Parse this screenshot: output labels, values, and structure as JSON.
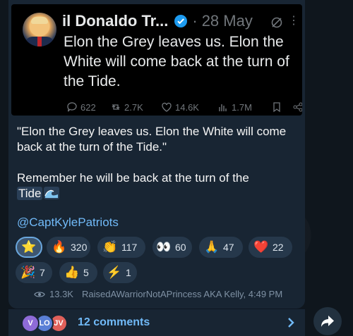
{
  "tweet": {
    "name": "il Donaldo Tr...",
    "date": "28 May",
    "text": "Elon the Grey leaves us. Elon the White will come back at the turn of the Tide.",
    "replies": "622",
    "retweets": "2.7K",
    "likes": "14.6K",
    "views": "1.7M",
    "icons": [
      "verified-icon",
      "grok-icon",
      "more-icon",
      "reply-icon",
      "retweet-icon",
      "like-icon",
      "views-icon",
      "bookmark-icon",
      "share-icon"
    ]
  },
  "message": {
    "quote": "\"Elon the Grey leaves us. Elon the White will come back at the turn of the Tide.\"",
    "line2": "Remember he will be back at the turn of the",
    "tide_word": "Tide",
    "tide_emoji": "wave-icon",
    "handle": "@CaptKylePatriots"
  },
  "reactions": [
    {
      "emoji": "⭐",
      "count": ""
    },
    {
      "emoji": "🔥",
      "count": "320"
    },
    {
      "emoji": "👏",
      "count": "117"
    },
    {
      "emoji": "👀",
      "count": "60"
    },
    {
      "emoji": "🙏",
      "count": "47"
    },
    {
      "emoji": "❤️",
      "count": "22"
    },
    {
      "emoji": "🎉",
      "count": "7"
    },
    {
      "emoji": "👍",
      "count": "5"
    },
    {
      "emoji": "⚡",
      "count": "1"
    }
  ],
  "footer": {
    "views": "13.3K",
    "author_time": "RaisedAWarriorNotAPrincess AKA Kelly, 4:49 PM"
  },
  "comments": {
    "avatars": [
      {
        "initials": "V",
        "color": "#8e6bd8"
      },
      {
        "initials": "LO",
        "color": "#5a7fd6"
      },
      {
        "initials": "JV",
        "color": "#e0605a"
      }
    ],
    "label": "12 comments"
  }
}
